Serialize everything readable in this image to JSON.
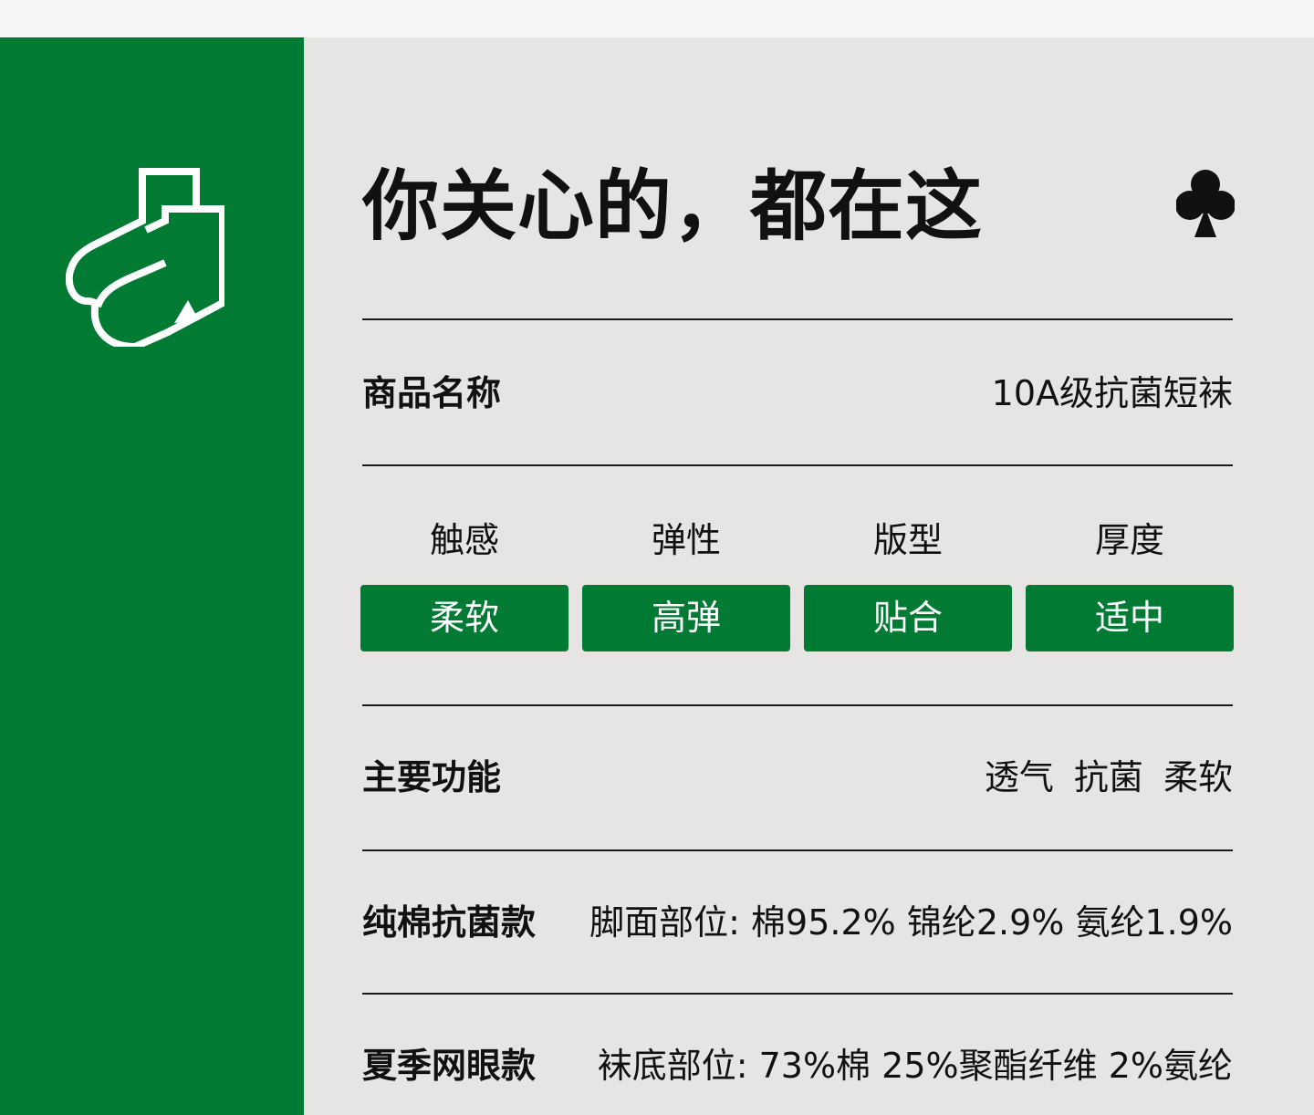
{
  "colors": {
    "brand_green": "#017a34",
    "panel_bg": "#e6e5e3",
    "text": "#111111",
    "pill_text": "#ffffff"
  },
  "sidebar": {
    "logo_icon": "sock-pair-icon"
  },
  "header": {
    "headline": "你关心的，都在这",
    "club_icon": "club-suit-icon"
  },
  "product": {
    "name_label": "商品名称",
    "name_value": "10A级抗菌短袜"
  },
  "attributes": [
    {
      "label": "触感",
      "value": "柔软"
    },
    {
      "label": "弹性",
      "value": "高弹"
    },
    {
      "label": "版型",
      "value": "贴合"
    },
    {
      "label": "厚度",
      "value": "适中"
    }
  ],
  "features": {
    "label": "主要功能",
    "value": "透气  抗菌  柔软"
  },
  "materials": [
    {
      "label": "纯棉抗菌款",
      "value": "脚面部位: 棉95.2% 锦纶2.9% 氨纶1.9%"
    },
    {
      "label": "夏季网眼款",
      "value": "袜底部位: 73%棉  25%聚酯纤维  2%氨纶"
    }
  ]
}
